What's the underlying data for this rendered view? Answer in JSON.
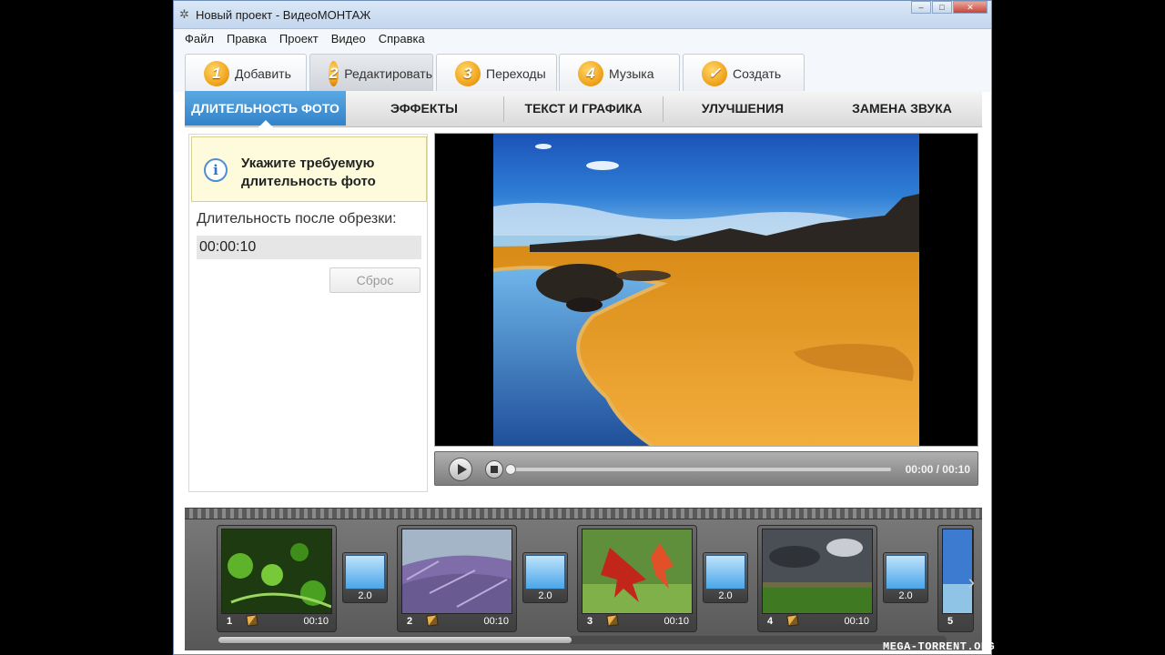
{
  "window": {
    "title": "Новый проект - ВидеоМОНТАЖ",
    "controls": [
      "–",
      "□",
      "✕"
    ]
  },
  "menu": [
    "Файл",
    "Правка",
    "Проект",
    "Видео",
    "Справка"
  ],
  "steps": [
    {
      "num": "1",
      "label": "Добавить"
    },
    {
      "num": "2",
      "label": "Редактировать"
    },
    {
      "num": "3",
      "label": "Переходы"
    },
    {
      "num": "4",
      "label": "Музыка"
    },
    {
      "num": "✓",
      "label": "Создать"
    }
  ],
  "edit_tabs": [
    "ДЛИТЕЛЬНОСТЬ ФОТО",
    "ЭФФЕКТЫ",
    "ТЕКСТ И ГРАФИКА",
    "УЛУЧШЕНИЯ",
    "ЗАМЕНА ЗВУКА"
  ],
  "duration_panel": {
    "info_text": "Укажите требуемую длительность фото",
    "label": "Длительность после обрезки:",
    "value": "00:00:10",
    "reset_label": "Сброс"
  },
  "player": {
    "time": "00:00 / 00:10"
  },
  "timeline": {
    "clips": [
      {
        "num": "1",
        "time": "00:10"
      },
      {
        "num": "2",
        "time": "00:10"
      },
      {
        "num": "3",
        "time": "00:10"
      },
      {
        "num": "4",
        "time": "00:10"
      },
      {
        "num": "5",
        "time": ""
      }
    ],
    "transitions": [
      "2.0",
      "2.0",
      "2.0",
      "2.0"
    ]
  },
  "watermark": "MEGA-TORRENT.ORG",
  "colors": {
    "active_tab": "#3a8fd4",
    "step_badge": "#f0a21a",
    "info_bg": "#fdfbdc"
  }
}
